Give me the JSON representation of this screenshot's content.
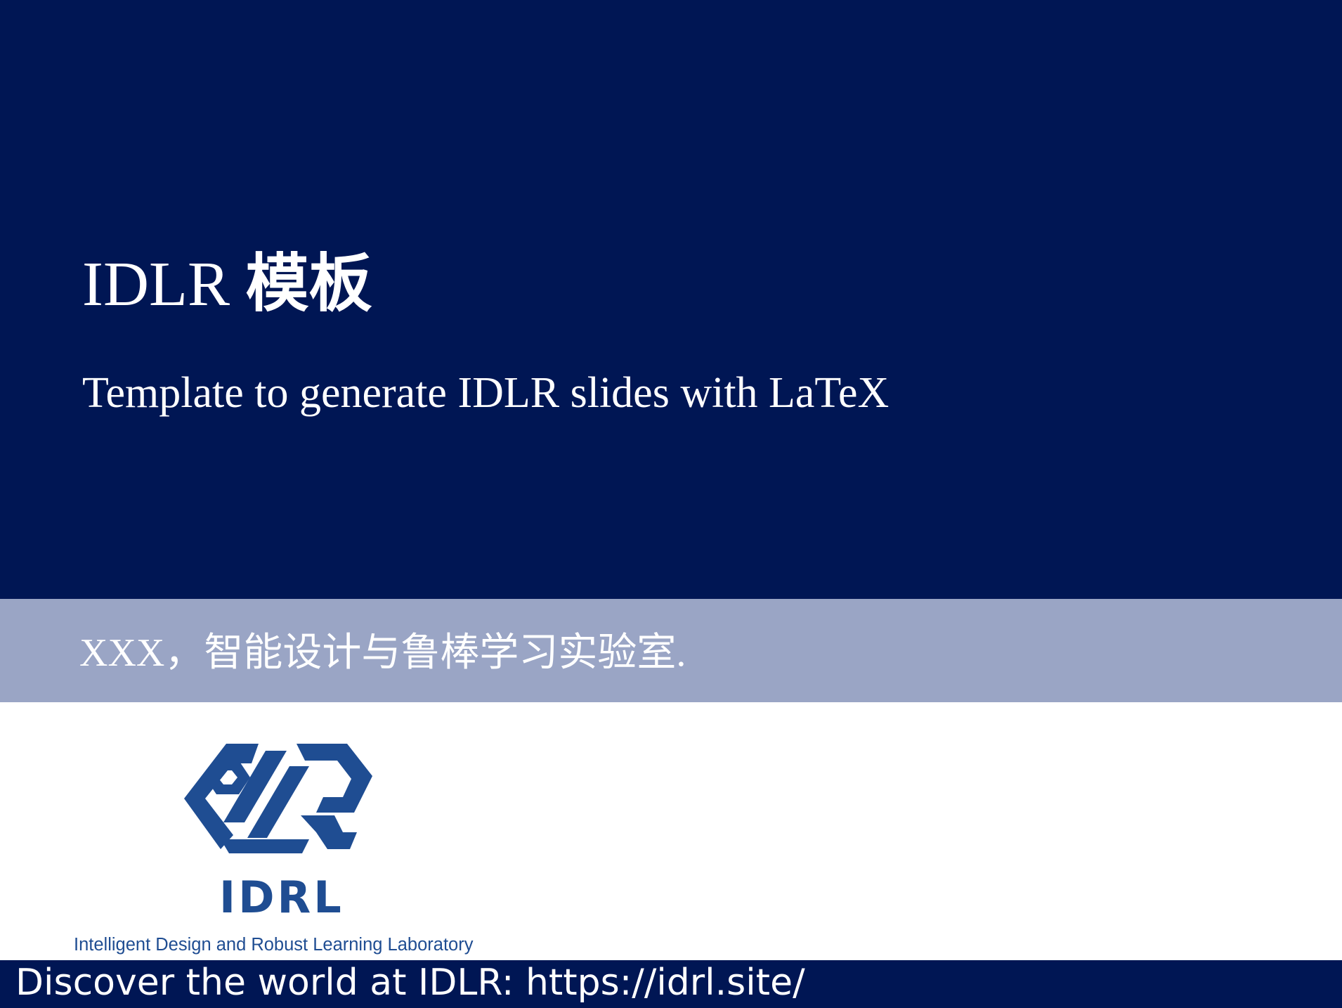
{
  "slide": {
    "title_latin": "IDLR",
    "title_cjk": "模板",
    "subtitle": "Template to generate IDLR slides with LaTeX",
    "author_line": "XXX，智能设计与鲁棒学习实验室."
  },
  "logo": {
    "wordmark": "IDRL",
    "tagline": "Intelligent Design and Robust Learning Laboratory",
    "color": "#1f4d92"
  },
  "footer": {
    "text": "Discover the world at IDLR: https://idrl.site/"
  },
  "colors": {
    "primary_navy": "#001654",
    "band_lavender": "#9aa5c5",
    "text_white": "#ffffff"
  }
}
